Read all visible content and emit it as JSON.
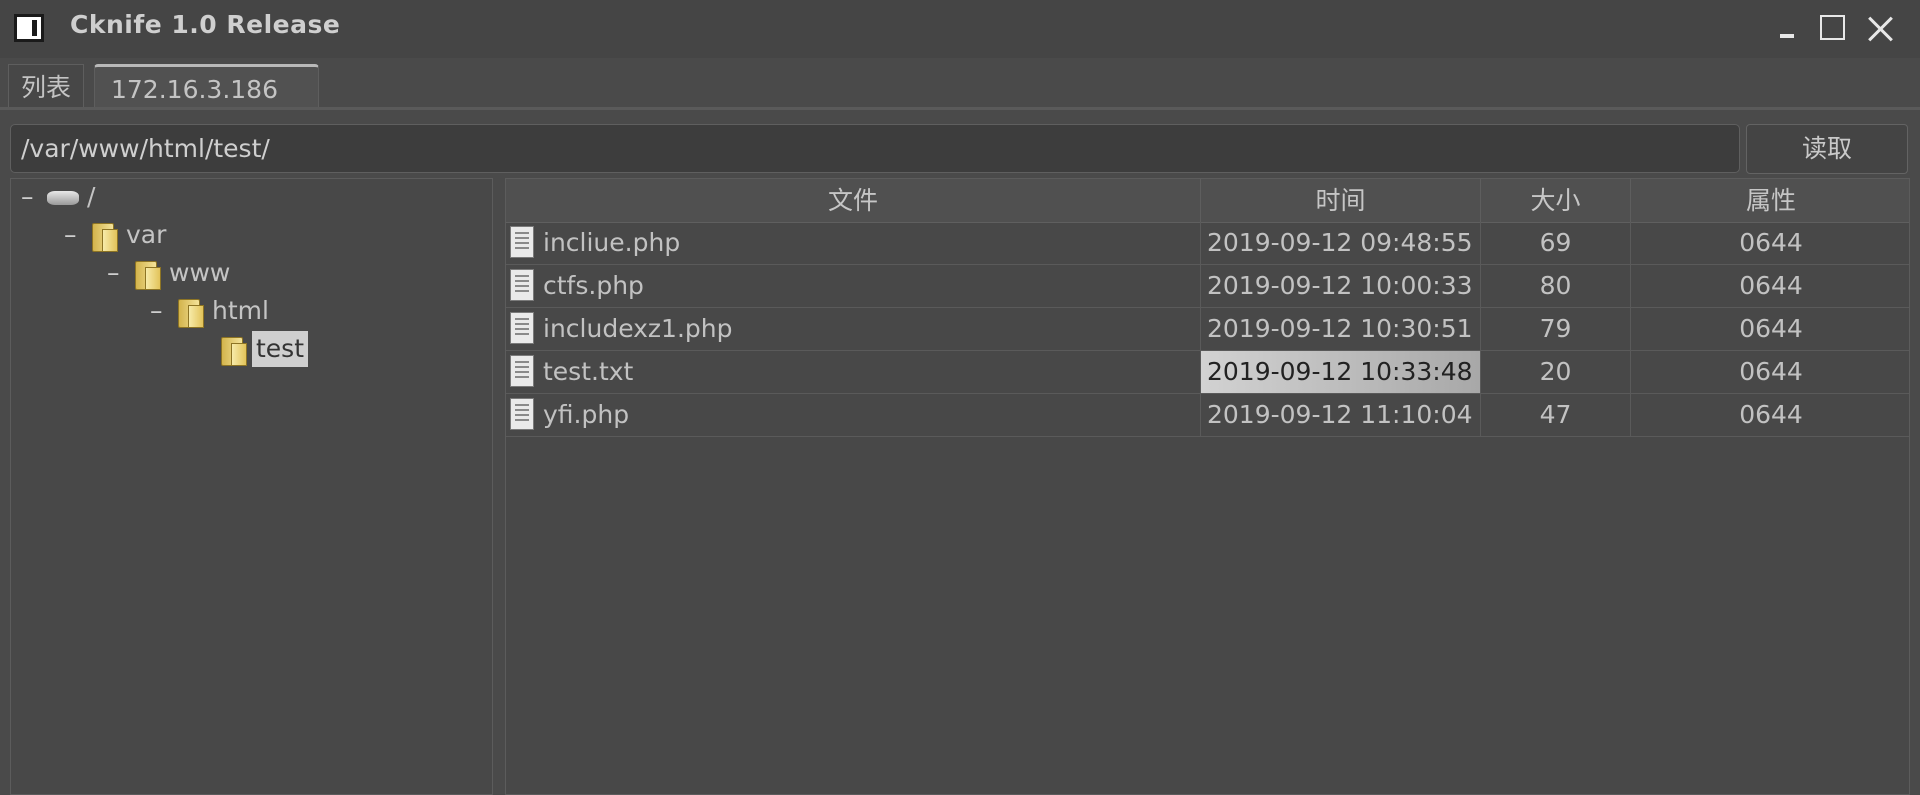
{
  "window": {
    "title": "Cknife 1.0 Release"
  },
  "tabs": [
    {
      "label": "列表"
    },
    {
      "label": "172.16.3.186"
    }
  ],
  "path_bar": {
    "value": "/var/www/html/test/",
    "read_button": "读取"
  },
  "tree": {
    "root": "/",
    "nodes": [
      {
        "label": "var"
      },
      {
        "label": "www"
      },
      {
        "label": "html"
      },
      {
        "label": "test",
        "selected": true
      }
    ]
  },
  "table": {
    "columns": [
      "文件",
      "时间",
      "大小",
      "属性"
    ],
    "rows": [
      {
        "name": "incliue.php",
        "time": "2019-09-12 09:48:55",
        "size": "69",
        "perm": "0644"
      },
      {
        "name": "ctfs.php",
        "time": "2019-09-12 10:00:33",
        "size": "80",
        "perm": "0644"
      },
      {
        "name": "includexz1.php",
        "time": "2019-09-12 10:30:51",
        "size": "79",
        "perm": "0644"
      },
      {
        "name": "test.txt",
        "time": "2019-09-12 10:33:48",
        "size": "20",
        "perm": "0644",
        "selected_cell": "time"
      },
      {
        "name": "yfi.php",
        "time": "2019-09-12 11:10:04",
        "size": "47",
        "perm": "0644"
      }
    ]
  }
}
